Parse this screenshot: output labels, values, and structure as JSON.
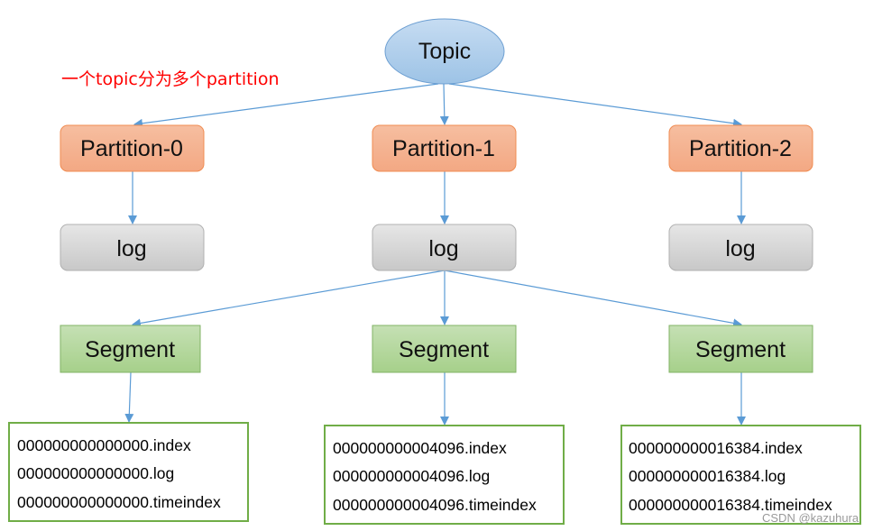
{
  "topic": {
    "label": "Topic"
  },
  "note": "一个topic分为多个partition",
  "partitions": [
    {
      "label": "Partition-0",
      "log": "log"
    },
    {
      "label": "Partition-1",
      "log": "log"
    },
    {
      "label": "Partition-2",
      "log": "log"
    }
  ],
  "segments": [
    {
      "label": "Segment",
      "files": [
        "000000000000000.index",
        "000000000000000.log",
        "000000000000000.timeindex"
      ]
    },
    {
      "label": "Segment",
      "files": [
        "000000000004096.index",
        "000000000004096.log",
        "000000000004096.timeindex"
      ]
    },
    {
      "label": "Segment",
      "files": [
        "000000000016384.index",
        "000000000016384.log",
        "000000000016384.timeindex"
      ]
    }
  ],
  "watermark": "CSDN @kazuhura",
  "colors": {
    "arrow": "#5b9bd5",
    "partition_fill": "#f4b183",
    "partition_border": "#ed7d31",
    "log_fill": "#d0d0d0",
    "segment_fill": "#a9d18e",
    "segment_border": "#70ad47",
    "note": "#ff0000"
  }
}
